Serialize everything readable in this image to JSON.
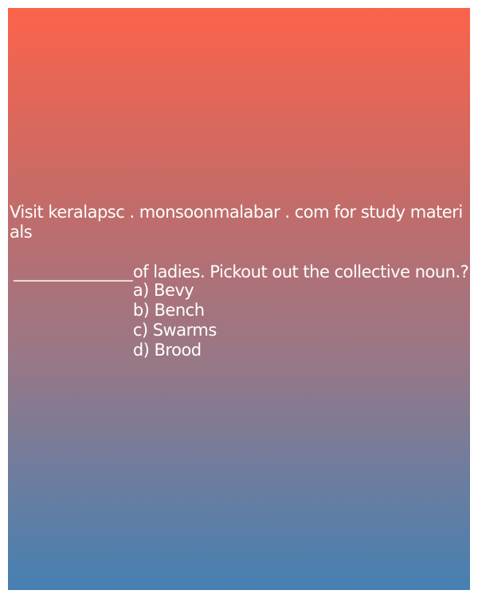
{
  "header": {
    "visit_text": "Visit keralapsc . monsoonmalabar . com for study materials"
  },
  "question": {
    "blank": "______________",
    "text": "of ladies. Pickout out the collective noun.?",
    "options": [
      "a) Bevy",
      "b) Bench",
      "c) Swarms",
      "d) Brood"
    ]
  },
  "colors": {
    "gradient_top": "#fb634a",
    "gradient_bottom": "#4680b2",
    "text": "#ffffff"
  }
}
